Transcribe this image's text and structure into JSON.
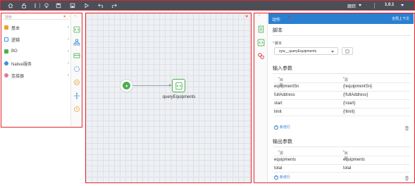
{
  "toolbar": {
    "buttons": [
      "home-icon",
      "lock-icon",
      "info-icon",
      "bulb-icon",
      "save-icon",
      "save-as-icon",
      "run-icon",
      "undo-icon",
      "redo-icon"
    ],
    "trace_label": "跟踪",
    "version": "1.0.1",
    "border_color": "#e0262d"
  },
  "palette": {
    "search_placeholder": "搜索",
    "categories": [
      {
        "label": "基本",
        "icon": "basic-icon",
        "color": "#f0a030"
      },
      {
        "label": "逻辑",
        "icon": "logic-icon",
        "color": "#3f8fd8"
      },
      {
        "label": "BO",
        "icon": "bo-icon",
        "color": "#4caf50"
      },
      {
        "label": "Native服务",
        "icon": "native-service-icon",
        "color": "#3f8fd8"
      },
      {
        "label": "连接器",
        "icon": "connector-icon",
        "color": "#e07aa0"
      }
    ]
  },
  "canvas": {
    "start_node": "start",
    "action_node_label": "queryEquipments"
  },
  "properties": {
    "tab_title": "动作",
    "context_link": "全局上下文",
    "script_section": "脚本",
    "script_field_label": "脚本",
    "script_value": "syw__queryEquipments",
    "input_section": "输入参数",
    "input_headers": {
      "target": "目标",
      "source": "源"
    },
    "inputs": [
      {
        "target": "equipmentSn",
        "source": "{!equipmentSn}"
      },
      {
        "target": "fullAddress",
        "source": "{!fullAddress}"
      },
      {
        "target": "start",
        "source": "{!start}"
      },
      {
        "target": "limit",
        "source": "{!limit}"
      }
    ],
    "add_row_label": "新增行",
    "output_section": "输出参数",
    "output_headers": {
      "source": "源",
      "target": "目标"
    },
    "outputs": [
      {
        "source": "equipments",
        "target": "equipments"
      },
      {
        "source": "total",
        "target": "total"
      }
    ],
    "accent_color": "#2b7fd1"
  }
}
